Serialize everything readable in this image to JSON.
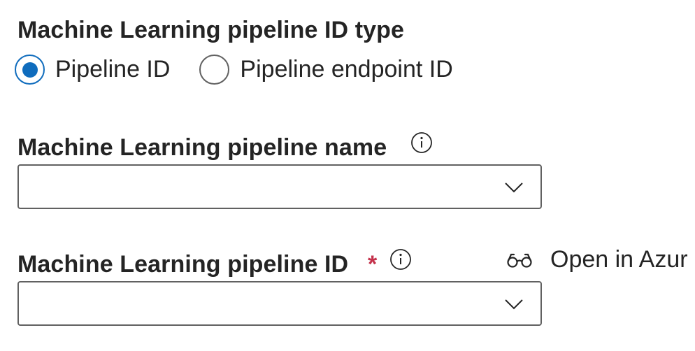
{
  "pipeline_id_type": {
    "label": "Machine Learning pipeline ID type",
    "options": [
      {
        "label": "Pipeline ID",
        "selected": true
      },
      {
        "label": "Pipeline endpoint ID",
        "selected": false
      }
    ]
  },
  "pipeline_name": {
    "label": "Machine Learning pipeline name",
    "info_icon": "info-icon",
    "value": ""
  },
  "pipeline_id": {
    "label": "Machine Learning pipeline ID",
    "required_marker": "*",
    "info_icon": "info-icon",
    "value": ""
  },
  "open_link": {
    "icon": "glasses-icon",
    "label": "Open in Azur"
  },
  "colors": {
    "accent": "#0f6cbd",
    "required": "#c4314b",
    "border": "#616161",
    "text": "#242424"
  }
}
